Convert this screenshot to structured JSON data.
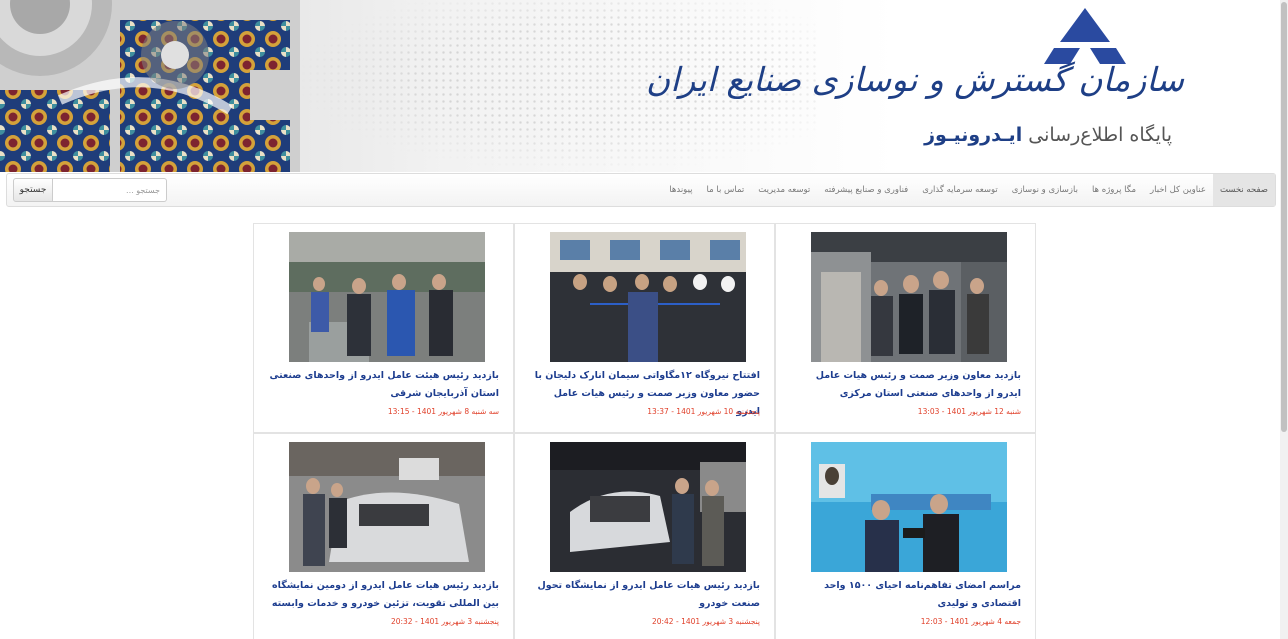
{
  "header": {
    "org_title": "سازمان گسترش و نوسازی صنایع ایران",
    "portal_title_prefix": "پایگاه اطلاع‌رسانی",
    "portal_title_name": "ایـدرونیـوز"
  },
  "nav": {
    "items": [
      "صفحه نخست",
      "عناوین کل اخبار",
      "مگا پروژه ها",
      "بازسازی و نوسازی",
      "توسعه سرمایه گذاری",
      "فناوری و صنایع پیشرفته",
      "توسعه مدیریت",
      "تماس با ما",
      "پیوندها"
    ],
    "active_index": 0
  },
  "search": {
    "placeholder": "جستجو ...",
    "button_label": "جستجو"
  },
  "news": [
    {
      "headline": "بازدید معاون وزیر صمت و رئیس هیات عامل ایدرو از واحدهای صنعتی استان مرکزی",
      "date": "شنبه 12 شهریور 1401 - 13:03"
    },
    {
      "headline": "افتتاح نیروگاه ۱۲مگاواتی سیمان انارک دلیجان با حضور معاون وزیر صمت و رئیس هیات عامل ایدرو",
      "date": "پنجشنبه 10 شهریور 1401 - 13:37"
    },
    {
      "headline": "بازدید رئیس هیئت عامل ایدرو از واحدهای صنعتی استان آذربایجان شرقی",
      "date": "سه شنبه 8 شهریور 1401 - 13:15"
    },
    {
      "headline": "مراسم امضای تفاهم‌نامه احیای ۱۵۰۰ واحد اقتصادی و تولیدی",
      "date": "جمعه 4 شهریور 1401 - 12:03"
    },
    {
      "headline": "بازدید رئیس هیات عامل ایدرو از نمایشگاه تحول صنعت خودرو",
      "date": "پنجشنبه 3 شهریور 1401 - 20:42"
    },
    {
      "headline": "بازدید رئیس هیات عامل ایدرو از دومین نمایشگاه بین المللی تقویت، تزئین خودرو و خدمات وابسته",
      "date": "پنجشنبه 3 شهریور 1401 - 20:32"
    }
  ],
  "colors": {
    "brand_blue": "#1e3f86",
    "headline_blue": "#1d3d8f",
    "date_red": "#e0412b"
  }
}
